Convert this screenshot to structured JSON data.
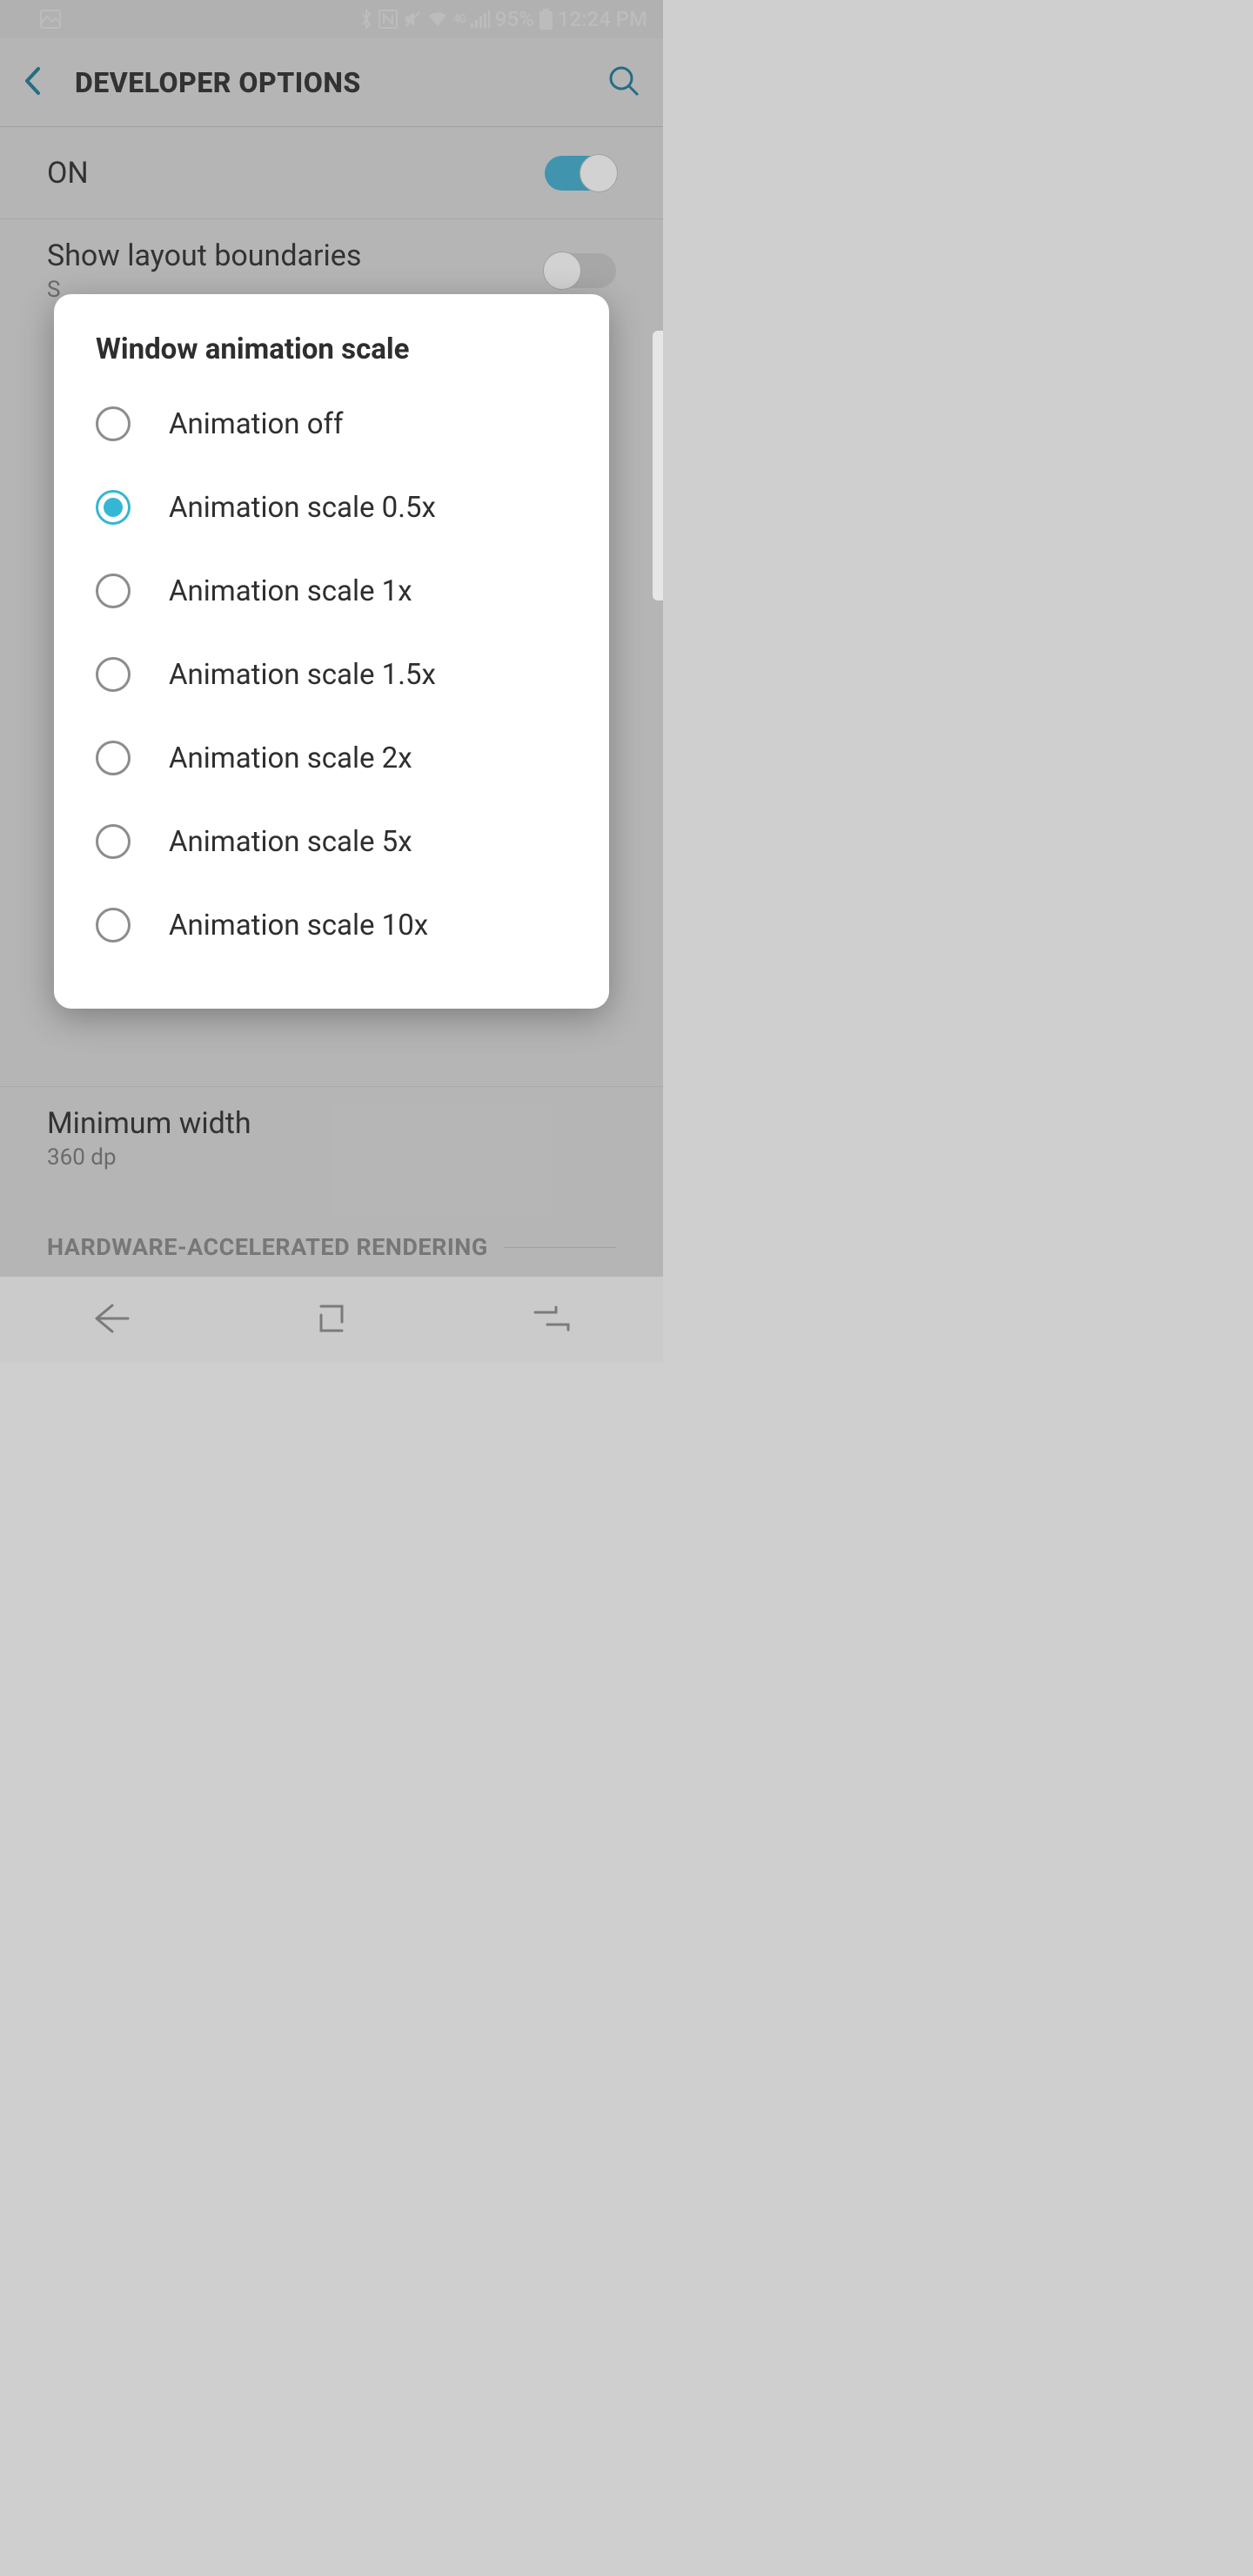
{
  "status_bar": {
    "battery_pct": "95%",
    "time": "12:24 PM",
    "network_label": "4G",
    "icons": {
      "picture": "picture-icon",
      "bluetooth": "bluetooth-icon",
      "nfc": "nfc-icon",
      "mute": "mute-icon",
      "wifi": "wifi-icon",
      "signal": "signal-icon",
      "battery": "battery-icon"
    }
  },
  "appbar": {
    "title": "DEVELOPER OPTIONS",
    "back": "back",
    "search": "search"
  },
  "main_toggle": {
    "label": "ON",
    "state": "on"
  },
  "settings": {
    "layout_boundaries": {
      "title": "Show layout boundaries",
      "sub_prefix": "S",
      "toggled": false
    },
    "min_width": {
      "title": "Minimum width",
      "value": "360 dp"
    },
    "section": "HARDWARE-ACCELERATED RENDERING"
  },
  "dialog": {
    "title": "Window animation scale",
    "selected_index": 1,
    "options": [
      "Animation off",
      "Animation scale 0.5x",
      "Animation scale 1x",
      "Animation scale 1.5x",
      "Animation scale 2x",
      "Animation scale 5x",
      "Animation scale 10x"
    ]
  },
  "accent": "#35b6d4"
}
